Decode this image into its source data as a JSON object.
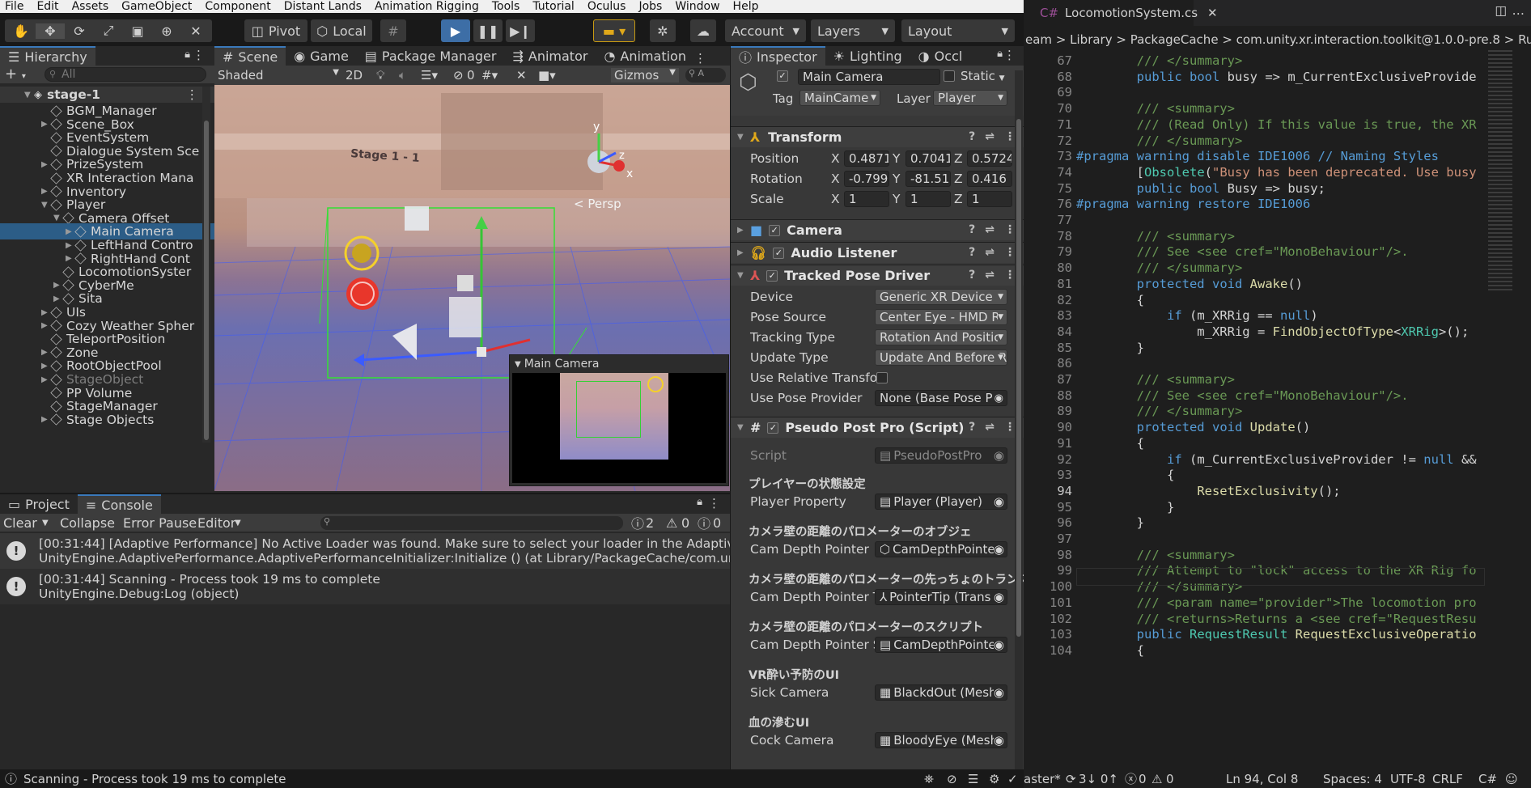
{
  "menu": [
    "File",
    "Edit",
    "Assets",
    "GameObject",
    "Component",
    "Distant Lands",
    "Animation Rigging",
    "Tools",
    "Tutorial",
    "Oculus",
    "Jobs",
    "Window",
    "Help"
  ],
  "toolbar": {
    "pivot": "Pivot",
    "local": "Local",
    "account": "Account",
    "layers": "Layers",
    "layout": "Layout"
  },
  "hierarchy": {
    "tab": "Hierarchy",
    "search_placeholder": "All",
    "scene_name": "stage-1",
    "items": [
      {
        "label": "BGM_Manager",
        "indent": 1,
        "arrow": false
      },
      {
        "label": "Scene_Box",
        "indent": 1,
        "arrow": true
      },
      {
        "label": "EventSystem",
        "indent": 1,
        "arrow": false
      },
      {
        "label": "Dialogue System Sce",
        "indent": 1,
        "arrow": false
      },
      {
        "label": "PrizeSystem",
        "indent": 1,
        "arrow": true
      },
      {
        "label": "XR Interaction Mana",
        "indent": 1,
        "arrow": false
      },
      {
        "label": "Inventory",
        "indent": 1,
        "arrow": true
      },
      {
        "label": "Player",
        "indent": 1,
        "arrow": true,
        "open": true
      },
      {
        "label": "Camera Offset",
        "indent": 2,
        "arrow": true,
        "open": true
      },
      {
        "label": "Main Camera",
        "indent": 3,
        "arrow": true,
        "selected": true
      },
      {
        "label": "LeftHand Contro",
        "indent": 3,
        "arrow": true
      },
      {
        "label": "RightHand Cont",
        "indent": 3,
        "arrow": true
      },
      {
        "label": "LocomotionSyster",
        "indent": 2,
        "arrow": false
      },
      {
        "label": "CyberMe",
        "indent": 2,
        "arrow": true
      },
      {
        "label": "Sita",
        "indent": 2,
        "arrow": true
      },
      {
        "label": "UIs",
        "indent": 1,
        "arrow": true
      },
      {
        "label": "Cozy Weather Spher",
        "indent": 1,
        "arrow": true
      },
      {
        "label": "TeleportPosition",
        "indent": 1,
        "arrow": false
      },
      {
        "label": "Zone",
        "indent": 1,
        "arrow": true
      },
      {
        "label": "RootObjectPool",
        "indent": 1,
        "arrow": true
      },
      {
        "label": "StageObject",
        "indent": 1,
        "arrow": true,
        "dim": true
      },
      {
        "label": "PP Volume",
        "indent": 1,
        "arrow": false
      },
      {
        "label": "StageManager",
        "indent": 1,
        "arrow": false
      },
      {
        "label": "Stage Objects",
        "indent": 1,
        "arrow": true
      }
    ]
  },
  "scene": {
    "tabs": [
      "Scene",
      "Game",
      "Package Manager",
      "Animator",
      "Animation"
    ],
    "shading": "Shaded",
    "mode2d": "2D",
    "hidden_count": "0",
    "gizmos": "Gizmos",
    "persp": "Persp",
    "stage_label": "Stage 1 - 1",
    "preview_title": "Main Camera",
    "axes": {
      "y": "y",
      "z": "z",
      "x": "x"
    }
  },
  "console": {
    "tabs": [
      "Project",
      "Console"
    ],
    "clear": "Clear",
    "collapse": "Collapse",
    "error_pause": "Error Pause",
    "editor": "Editor",
    "counts": {
      "info": "2",
      "warn": "0",
      "error": "0"
    },
    "logs": [
      {
        "line1": "[00:31:44] [Adaptive Performance] No Active Loader was found. Make sure to select your loader in the Adaptive Perforn",
        "line2": "UnityEngine.AdaptivePerformance.AdaptivePerformanceInitializer:Initialize () (at Library/PackageCache/com.unity.adap"
      },
      {
        "line1": "[00:31:44] Scanning - Process took 19 ms to complete",
        "line2": "UnityEngine.Debug:Log (object)"
      }
    ]
  },
  "inspector": {
    "tabs": [
      "Inspector",
      "Lighting",
      "Occl"
    ],
    "object_name": "Main Camera",
    "static": "Static",
    "tag_label": "Tag",
    "tag": "MainCame",
    "layer_label": "Layer",
    "layer": "Player",
    "transform": {
      "title": "Transform",
      "position": {
        "label": "Position",
        "x": "0.4871",
        "y": "0.7041",
        "z": "0.5724"
      },
      "rotation": {
        "label": "Rotation",
        "x": "-0.799",
        "y": "-81.51",
        "z": "0.416"
      },
      "scale": {
        "label": "Scale",
        "x": "1",
        "y": "1",
        "z": "1"
      }
    },
    "camera": "Camera",
    "audio": "Audio Listener",
    "tpd": {
      "title": "Tracked Pose Driver",
      "rows": [
        {
          "label": "Device",
          "value": "Generic XR Device"
        },
        {
          "label": "Pose Source",
          "value": "Center Eye - HMD R"
        },
        {
          "label": "Tracking Type",
          "value": "Rotation And Positic"
        },
        {
          "label": "Update Type",
          "value": "Update And Before R"
        },
        {
          "label": "Use Relative Transfo",
          "value": ""
        },
        {
          "label": "Use Pose Provider",
          "value": "None (Base Pose P"
        }
      ]
    },
    "pseudo": {
      "title": "Pseudo Post Pro (Script)",
      "script_label": "Script",
      "script": "PseudoPostPro",
      "sections": [
        {
          "heading": "プレイヤーの状態設定",
          "label": "Player Property",
          "value": "Player (Player)"
        },
        {
          "heading": "カメラ壁の距離のパロメーターのオブジェ",
          "label": "Cam Depth Pointer",
          "value": "CamDepthPointe"
        },
        {
          "heading": "カメラ壁の距離のパロメーターの先っちょのトランス",
          "label": "Cam Depth Pointer T",
          "value": "PointerTip (Trans"
        },
        {
          "heading": "カメラ壁の距離のパロメーターのスクリプト",
          "label": "Cam Depth Pointer S",
          "value": "CamDepthPointe"
        },
        {
          "heading": "VR酔い予防のUI",
          "label": "Sick Camera",
          "value": "BlackdOut (Mesh"
        },
        {
          "heading": "血の滲むUI",
          "label": "Cock Camera",
          "value": "BloodyEye (Mesh"
        }
      ]
    }
  },
  "status_bar": {
    "message": "Scanning - Process took 19 ms to complete"
  },
  "editor": {
    "tab": "LocomotionSystem.cs",
    "breadcrumb": [
      "eam",
      "Library",
      "PackageCache",
      "com.unity.xr.interaction.toolkit@1.0.0-pre.8",
      "Runtim"
    ],
    "lines": [
      {
        "n": "67",
        "t": "        /// </summary>"
      },
      {
        "n": "68",
        "t": "        public bool busy => m_CurrentExclusiveProvide"
      },
      {
        "n": "69",
        "t": ""
      },
      {
        "n": "70",
        "t": "        /// <summary>"
      },
      {
        "n": "71",
        "t": "        /// (Read Only) If this value is true, the XR"
      },
      {
        "n": "72",
        "t": "        /// </summary>"
      },
      {
        "n": "73",
        "t": "#pragma warning disable IDE1006 // Naming Styles"
      },
      {
        "n": "74",
        "t": "        [Obsolete(\"Busy has been deprecated. Use busy"
      },
      {
        "n": "75",
        "t": "        public bool Busy => busy;"
      },
      {
        "n": "76",
        "t": "#pragma warning restore IDE1006"
      },
      {
        "n": "77",
        "t": ""
      },
      {
        "n": "78",
        "t": "        /// <summary>"
      },
      {
        "n": "79",
        "t": "        /// See <see cref=\"MonoBehaviour\"/>."
      },
      {
        "n": "80",
        "t": "        /// </summary>"
      },
      {
        "n": "81",
        "t": "        protected void Awake()"
      },
      {
        "n": "82",
        "t": "        {"
      },
      {
        "n": "83",
        "t": "            if (m_XRRig == null)"
      },
      {
        "n": "84",
        "t": "                m_XRRig = FindObjectOfType<XRRig>();"
      },
      {
        "n": "85",
        "t": "        }"
      },
      {
        "n": "86",
        "t": ""
      },
      {
        "n": "87",
        "t": "        /// <summary>"
      },
      {
        "n": "88",
        "t": "        /// See <see cref=\"MonoBehaviour\"/>."
      },
      {
        "n": "89",
        "t": "        /// </summary>"
      },
      {
        "n": "90",
        "t": "        protected void Update()"
      },
      {
        "n": "91",
        "t": "        {"
      },
      {
        "n": "92",
        "t": "            if (m_CurrentExclusiveProvider != null &&"
      },
      {
        "n": "93",
        "t": "            {"
      },
      {
        "n": "94",
        "t": "                ResetExclusivity();"
      },
      {
        "n": "95",
        "t": "            }"
      },
      {
        "n": "96",
        "t": "        }"
      },
      {
        "n": "97",
        "t": ""
      },
      {
        "n": "98",
        "t": "        /// <summary>"
      },
      {
        "n": "99",
        "t": "        /// Attempt to \"lock\" access to the XR Rig fo"
      },
      {
        "n": "100",
        "t": "        /// </summary>"
      },
      {
        "n": "101",
        "t": "        /// <param name=\"provider\">The locomotion pro"
      },
      {
        "n": "102",
        "t": "        /// <returns>Returns a <see cref=\"RequestResu"
      },
      {
        "n": "103",
        "t": "        public RequestResult RequestExclusiveOperatio"
      },
      {
        "n": "104",
        "t": "        {"
      }
    ],
    "status": {
      "branch": "aster*",
      "sync": "3↓ 0↑",
      "problems_err": "0",
      "problems_warn": "0",
      "position": "Ln 94, Col 8",
      "spaces": "Spaces: 4",
      "encoding": "UTF-8",
      "eol": "CRLF",
      "language": "C#"
    }
  },
  "colors": {
    "accent": "#3a79bb",
    "selected_row": "#2c5d87",
    "play_active": "#3d6ea6",
    "keyword": "#569cd6",
    "comment": "#6a9955",
    "string": "#ce9178",
    "type": "#4ec9b0",
    "method": "#dcdcaa"
  }
}
